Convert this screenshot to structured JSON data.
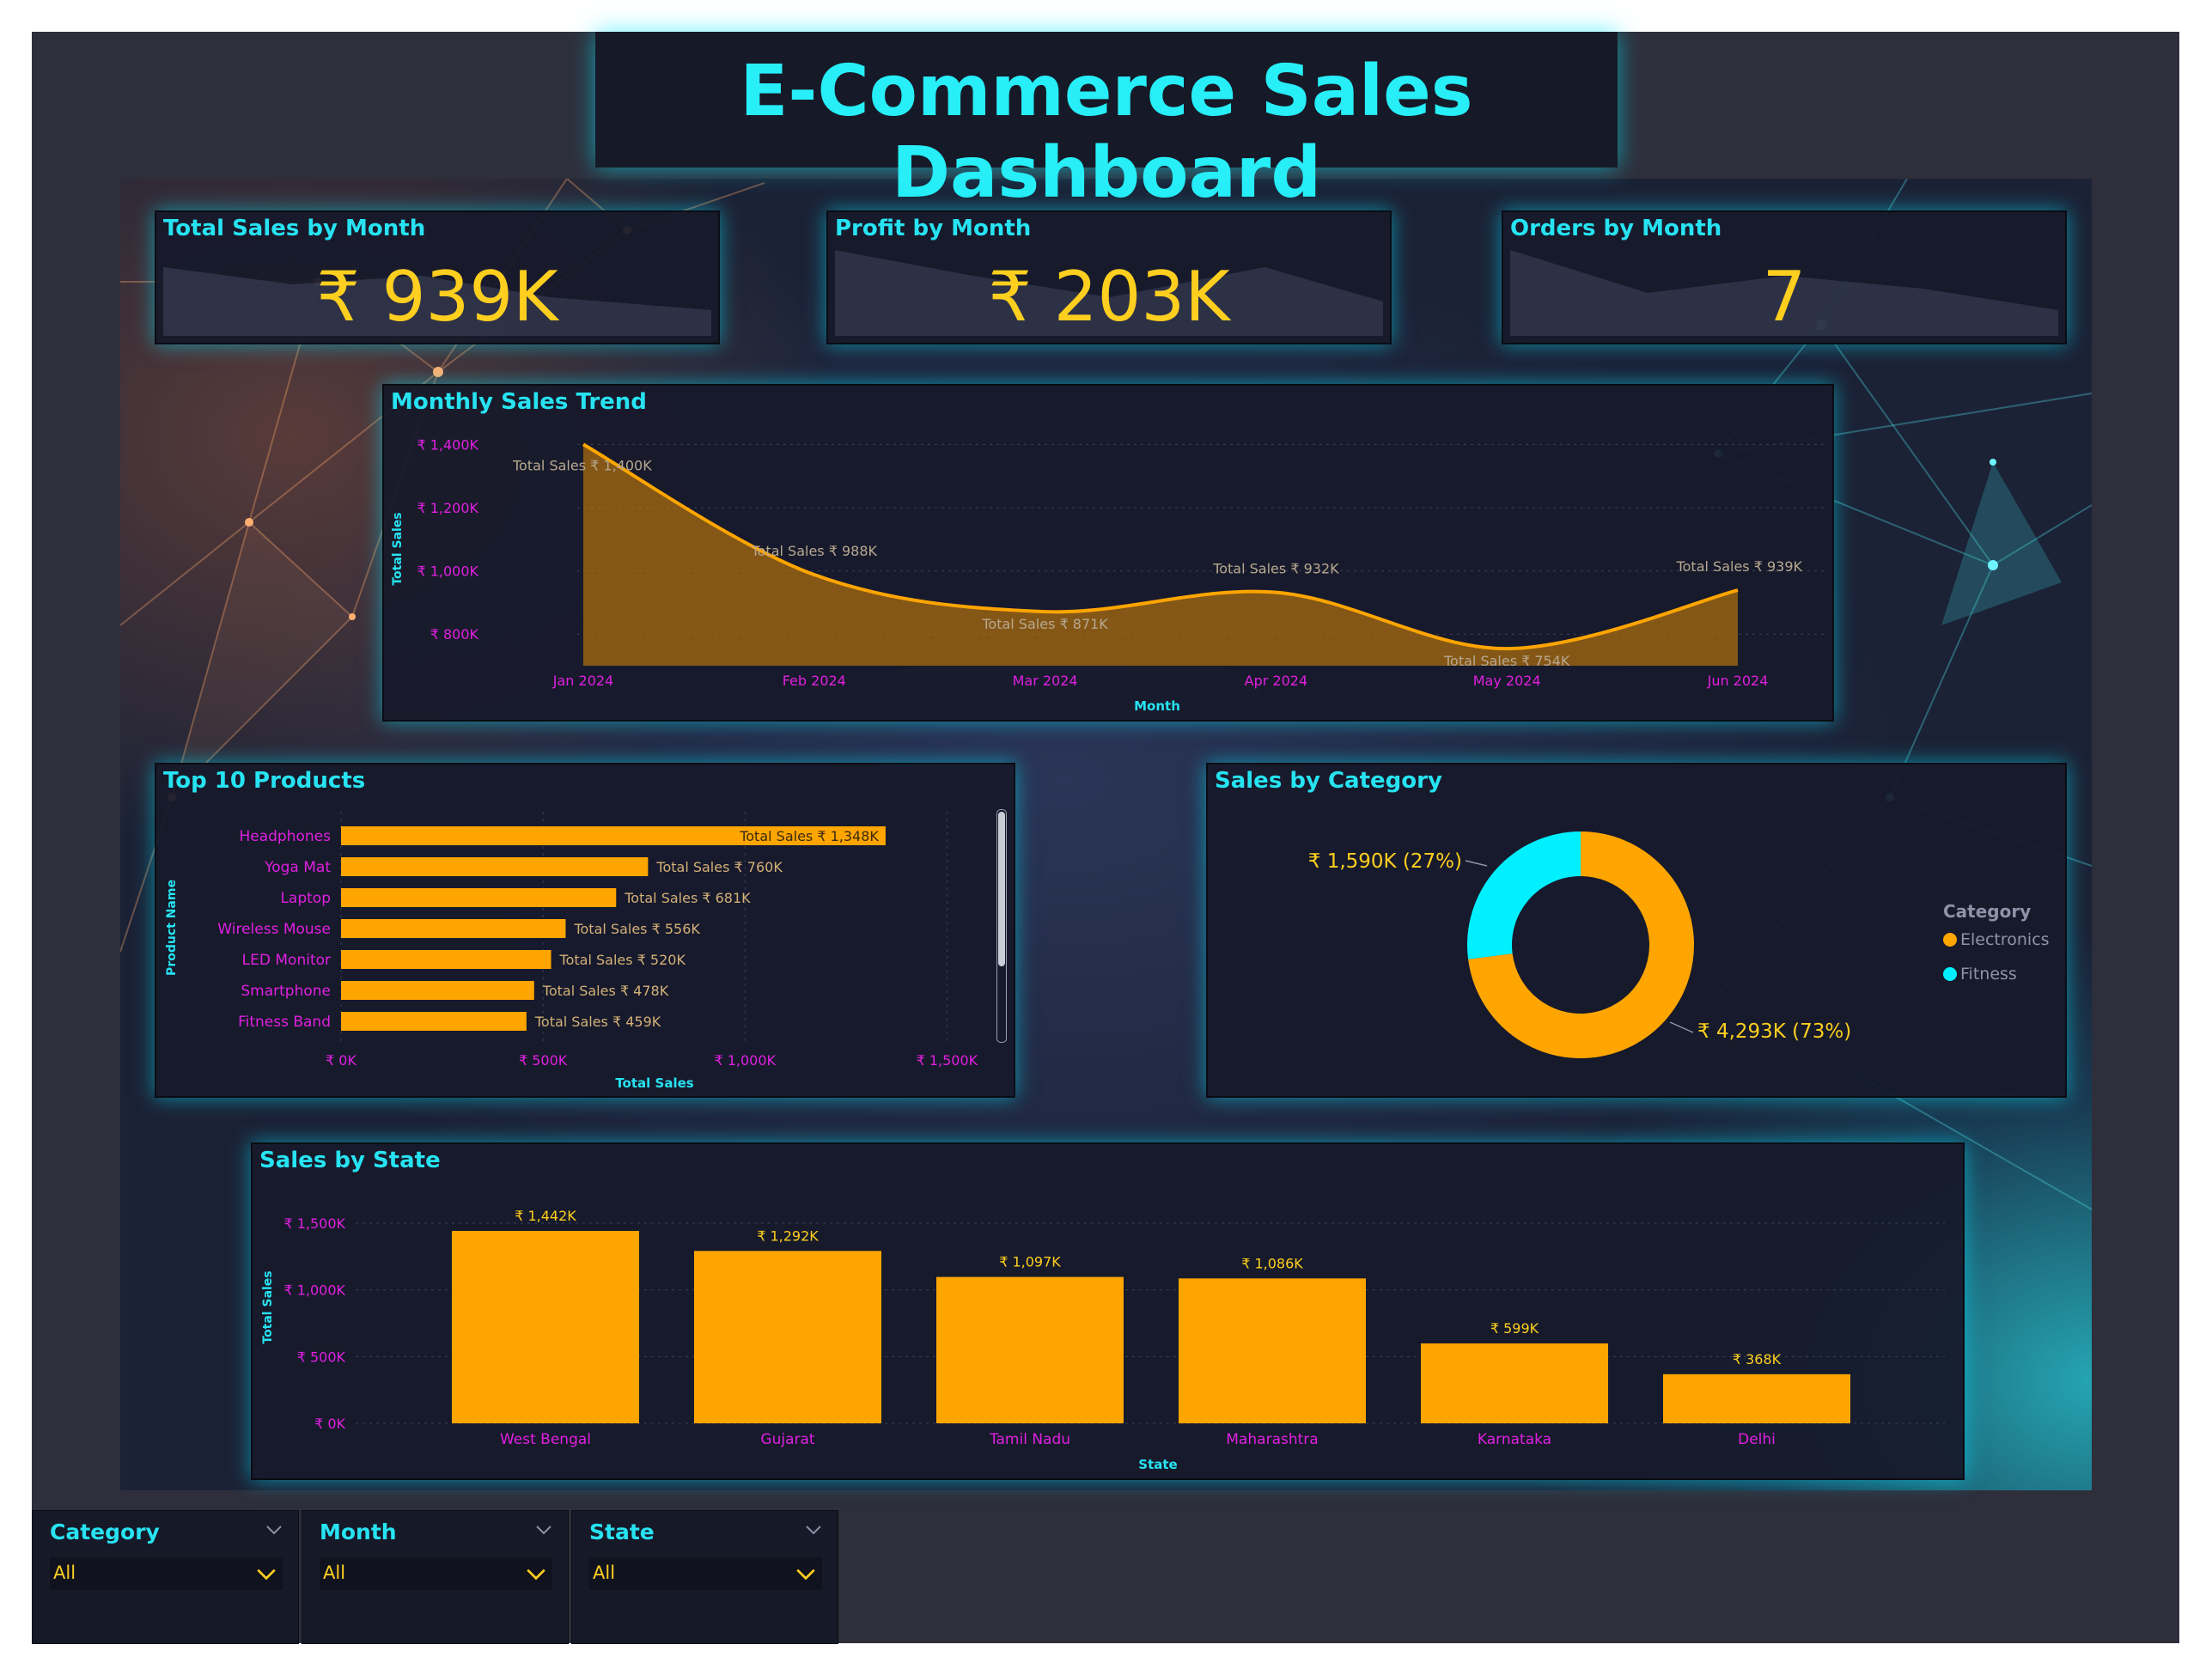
{
  "title": "E-Commerce Sales Dashboard",
  "colors": {
    "accent_cyan": "#27e3f2",
    "kpi_yellow": "#ffcf1f",
    "bar_orange": "#ffa500",
    "axis_magenta": "#e020e0",
    "panel_bg": "#161a28"
  },
  "kpis": [
    {
      "title": "Total Sales by Month",
      "value": "₹ 939K"
    },
    {
      "title": "Profit by Month",
      "value": "₹ 203K"
    },
    {
      "title": "Orders by Month",
      "value": "7"
    }
  ],
  "monthly_trend": {
    "title": "Monthly Sales Trend",
    "chart_data": {
      "type": "area",
      "x": [
        "Jan 2024",
        "Feb 2024",
        "Mar 2024",
        "Apr 2024",
        "May 2024",
        "Jun 2024"
      ],
      "y": [
        1400,
        988,
        871,
        932,
        754,
        939
      ],
      "units": "₹ K",
      "data_labels": [
        "Total Sales ₹ 1,400K",
        "Total Sales ₹ 988K",
        "Total Sales ₹ 871K",
        "Total Sales ₹ 932K",
        "Total Sales ₹ 754K",
        "Total Sales ₹ 939K"
      ],
      "xlabel": "Month",
      "ylabel": "Total Sales",
      "yticks": [
        "₹ 800K",
        "₹ 1,000K",
        "₹ 1,200K",
        "₹ 1,400K"
      ],
      "ytick_values": [
        800,
        1000,
        1200,
        1400
      ],
      "ylim": [
        700,
        1450
      ],
      "grid": true
    }
  },
  "top_products": {
    "title": "Top 10 Products",
    "chart_data": {
      "type": "bar",
      "orientation": "horizontal",
      "categories": [
        "Headphones",
        "Yoga Mat",
        "Laptop",
        "Wireless Mouse",
        "LED Monitor",
        "Smartphone",
        "Fitness Band"
      ],
      "values": [
        1348,
        760,
        681,
        556,
        520,
        478,
        459
      ],
      "data_labels": [
        "Total Sales ₹ 1,348K",
        "Total Sales ₹ 760K",
        "Total Sales ₹ 681K",
        "Total Sales ₹ 556K",
        "Total Sales ₹ 520K",
        "Total Sales ₹ 478K",
        "Total Sales ₹ 459K"
      ],
      "xlabel": "Total Sales",
      "ylabel": "Product Name",
      "xticks": [
        "₹ 0K",
        "₹ 500K",
        "₹ 1,000K",
        "₹ 1,500K"
      ],
      "xtick_values": [
        0,
        500,
        1000,
        1500
      ],
      "xlim": [
        0,
        1580
      ]
    }
  },
  "category": {
    "title": "Sales by Category",
    "chart_data": {
      "type": "pie",
      "donut": true,
      "categories": [
        "Electronics",
        "Fitness"
      ],
      "values": [
        4293,
        1590
      ],
      "colors": [
        "#ffa500",
        "#00f0ff"
      ],
      "data_labels": [
        "₹ 4,293K (73%)",
        "₹ 1,590K (27%)"
      ],
      "legend_title": "Category",
      "legend_position": "right"
    }
  },
  "state": {
    "title": "Sales by State",
    "chart_data": {
      "type": "bar",
      "categories": [
        "West Bengal",
        "Gujarat",
        "Tamil Nadu",
        "Maharashtra",
        "Karnataka",
        "Delhi"
      ],
      "values": [
        1442,
        1292,
        1097,
        1086,
        599,
        368
      ],
      "data_labels": [
        "₹ 1,442K",
        "₹ 1,292K",
        "₹ 1,097K",
        "₹ 1,086K",
        "₹ 599K",
        "₹ 368K"
      ],
      "xlabel": "State",
      "ylabel": "Total Sales",
      "yticks": [
        "₹ 0K",
        "₹ 500K",
        "₹ 1,000K",
        "₹ 1,500K"
      ],
      "ytick_values": [
        0,
        500,
        1000,
        1500
      ],
      "ylim": [
        0,
        1500
      ],
      "grid": true
    }
  },
  "slicers": [
    {
      "label": "Category",
      "value": "All"
    },
    {
      "label": "Month",
      "value": "All"
    },
    {
      "label": "State",
      "value": "All"
    }
  ]
}
